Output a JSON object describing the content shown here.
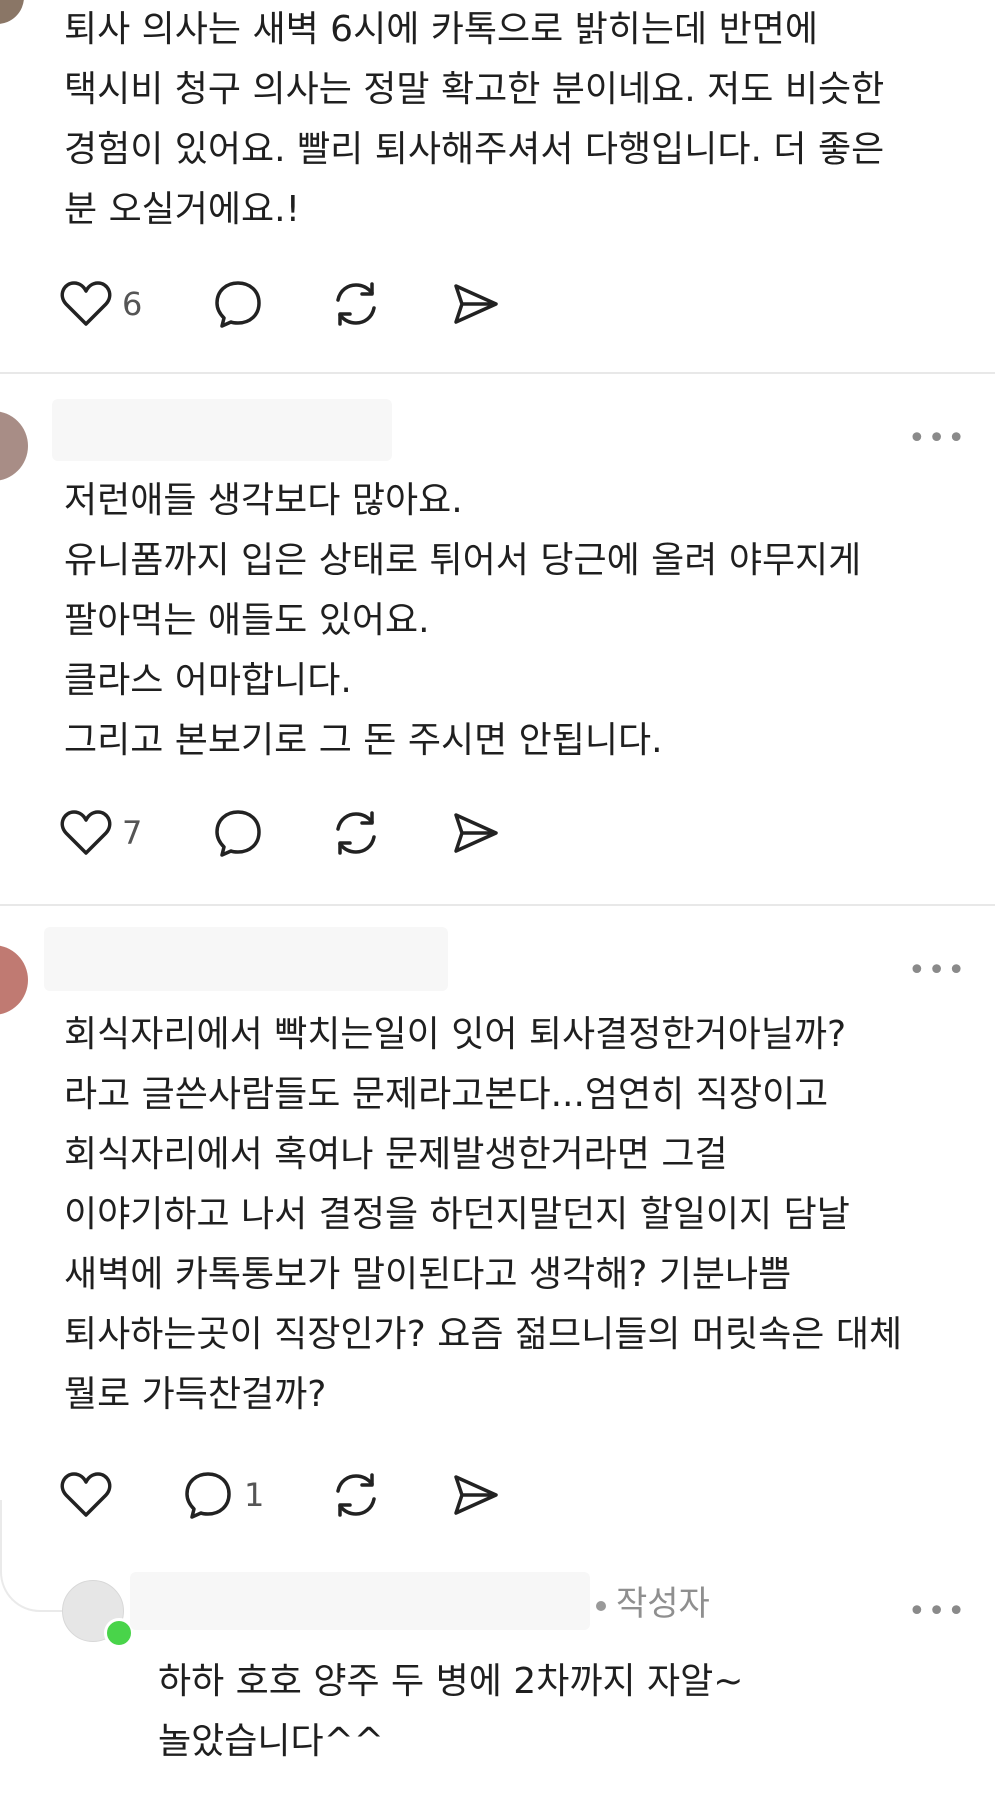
{
  "posts": [
    {
      "lines": [
        "퇴사 의사는 새벽 6시에 카톡으로 밝히는데 반면에",
        "택시비 청구 의사는 정말 확고한 분이네요. 저도 비슷한",
        "경험이 있어요. 빨리 퇴사해주셔서 다행입니다. 더 좋은",
        "분 오실거에요.!"
      ],
      "likes": "6"
    },
    {
      "lines": [
        "저런애들 생각보다 많아요.",
        "유니폼까지 입은 상태로 튀어서 당근에 올려 야무지게",
        "팔아먹는 애들도 있어요.",
        "클라스 어마합니다.",
        "그리고 본보기로 그 돈 주시면 안됩니다."
      ],
      "likes": "7"
    },
    {
      "lines": [
        "회식자리에서 빡치는일이 잇어 퇴사결정한거아닐까?",
        "라고 글쓴사람들도 문제라고본다...엄연히 직장이고",
        "회식자리에서 혹여나 문제발생한거라면 그걸",
        "이야기하고 나서 결정을 하던지말던지 할일이지 담날",
        "새벽에 카톡통보가 말이된다고 생각해? 기분나쁨",
        "퇴사하는곳이 직장인가? 요즘 젊므니들의 머릿속은 대체",
        "뭘로 가득찬걸까?"
      ],
      "replies": "1"
    }
  ],
  "reply": {
    "author_badge": "작성자",
    "lines": [
      "하하 호호 양주 두 병에 2차까지 자알~",
      "놀았습니다^^"
    ]
  },
  "more_glyph": "•••",
  "icons": {
    "like": "heart-icon",
    "comment": "comment-bubble-icon",
    "repost": "repost-icon",
    "share": "send-icon"
  },
  "colors": {
    "text": "#1f1f1f",
    "muted": "#8f8f8f",
    "divider": "#e8e8e8",
    "online": "#49d44a"
  }
}
